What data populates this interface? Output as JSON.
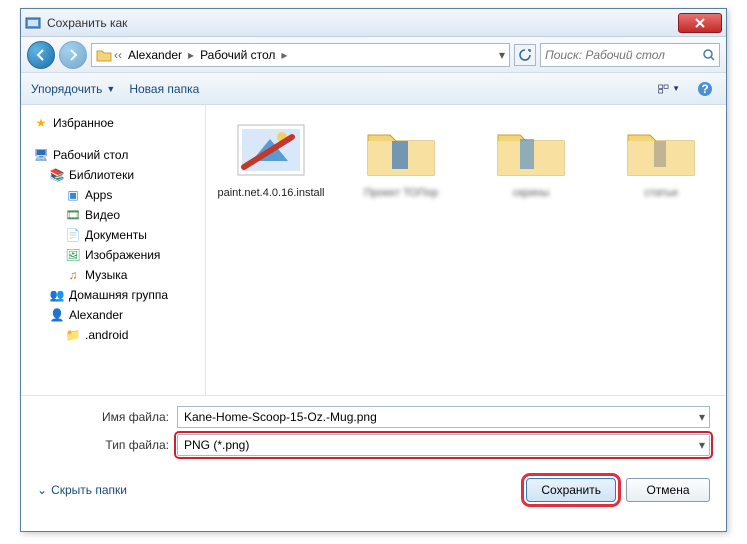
{
  "window": {
    "title": "Сохранить как"
  },
  "nav": {
    "crumbs": [
      "Alexander",
      "Рабочий стол"
    ],
    "search_placeholder": "Поиск: Рабочий стол"
  },
  "toolbar": {
    "organize": "Упорядочить",
    "new_folder": "Новая папка"
  },
  "sidebar": {
    "favorites": "Избранное",
    "desktop": "Рабочий стол",
    "libraries": "Библиотеки",
    "apps": "Apps",
    "video": "Видео",
    "documents": "Документы",
    "pictures": "Изображения",
    "music": "Музыка",
    "homegroup": "Домашняя группа",
    "user": "Alexander",
    "android": ".android"
  },
  "files": {
    "items": [
      {
        "label": "paint.net.4.0.16.install",
        "type": "image"
      },
      {
        "label": "Проект ТОПор",
        "type": "folder",
        "blurred": true
      },
      {
        "label": "скрины",
        "type": "folder",
        "blurred": true
      },
      {
        "label": "статьи",
        "type": "folder",
        "blurred": true
      }
    ]
  },
  "fields": {
    "filename_label": "Имя файла:",
    "filename_value": "Kane-Home-Scoop-15-Oz.-Mug.png",
    "filetype_label": "Тип файла:",
    "filetype_value": "PNG (*.png)"
  },
  "footer": {
    "hide_folders": "Скрыть папки",
    "save": "Сохранить",
    "cancel": "Отмена"
  }
}
